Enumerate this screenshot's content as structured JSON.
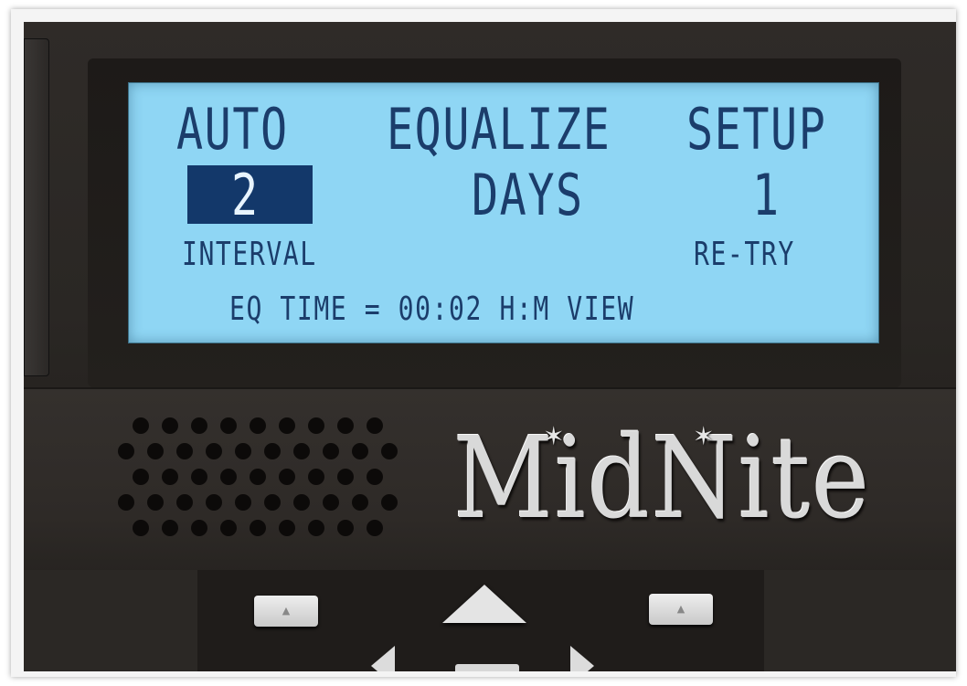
{
  "lcd": {
    "row1": {
      "left": "AUTO",
      "center": "EQUALIZE",
      "right": "SETUP"
    },
    "row2": {
      "left_value": "2",
      "center": "DAYS",
      "right_value": "1"
    },
    "row3": {
      "left_label": "INTERVAL",
      "right_label": "RE-TRY"
    },
    "row4": {
      "text": "EQ TIME = 00:02 H:M VIEW"
    },
    "selected_field": "interval"
  },
  "brand": {
    "logo_text": "MidNite"
  },
  "keypad": {
    "soft_left_glyph": "▲",
    "soft_right_glyph": "▲"
  },
  "colors": {
    "lcd_background": "#8fd6f4",
    "lcd_text": "#1b3d6b",
    "lcd_highlight": "#13386a",
    "housing": "#2f2b28",
    "buttons": "#e4e4e4"
  }
}
